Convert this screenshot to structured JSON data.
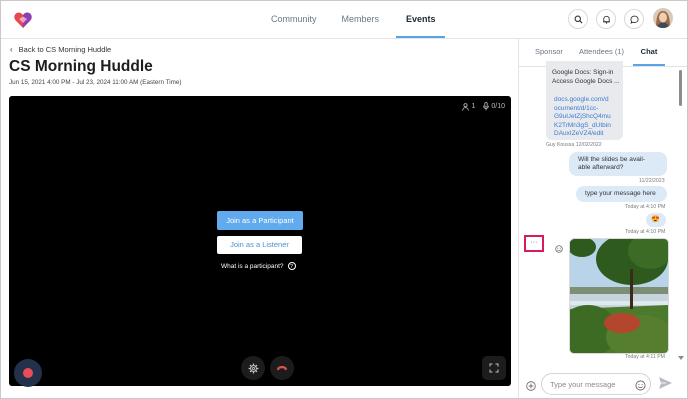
{
  "nav": {
    "links": [
      "Community",
      "Members",
      "Events"
    ],
    "active": "Events"
  },
  "event": {
    "back_label": "Back to CS Morning Huddle",
    "title": "CS Morning Huddle",
    "dates": "Jun 15, 2021 4:00 PM - Jul 23, 2024 11:00 AM (Eastern Time)"
  },
  "stage": {
    "participants_count": "1",
    "mic_count": "0/10",
    "join_participant": "Join as a Participant",
    "join_listener": "Join as a Listener",
    "what_is": "What is a participant?"
  },
  "panel": {
    "tabs": [
      "Sponsor",
      "Attendees (1)",
      "Chat"
    ],
    "active_tab": "Chat"
  },
  "chat": {
    "msg1_lines": [
      "Google Docs: Sign-in",
      "Access Google Docs ..."
    ],
    "msg1_link_lines": [
      "docs.google.com/d",
      "ocument/d/1cc-",
      "G9uUetZjShcQ4mu",
      "K2TrMn3gS_dUtbin",
      "DAuxIZeVZ4/edit"
    ],
    "msg1_meta": "Guy Koussa 12/02/2022",
    "msg2_lines": [
      "Will the slides be avail-",
      "able afterward?"
    ],
    "msg2_meta": "11/22/2023",
    "msg3": "type your message here",
    "msg3_meta": "Today at 4:10 PM",
    "msg4_emoji": "😍",
    "msg4_meta": "Today at 4:10 PM",
    "more_label": "···",
    "photo_meta": "Today at 4:11 PM"
  },
  "composer": {
    "placeholder": "Type your message"
  },
  "colors": {
    "accent": "#62aaee",
    "highlight_border": "#d81b60",
    "record_dot": "#e84d5c"
  }
}
